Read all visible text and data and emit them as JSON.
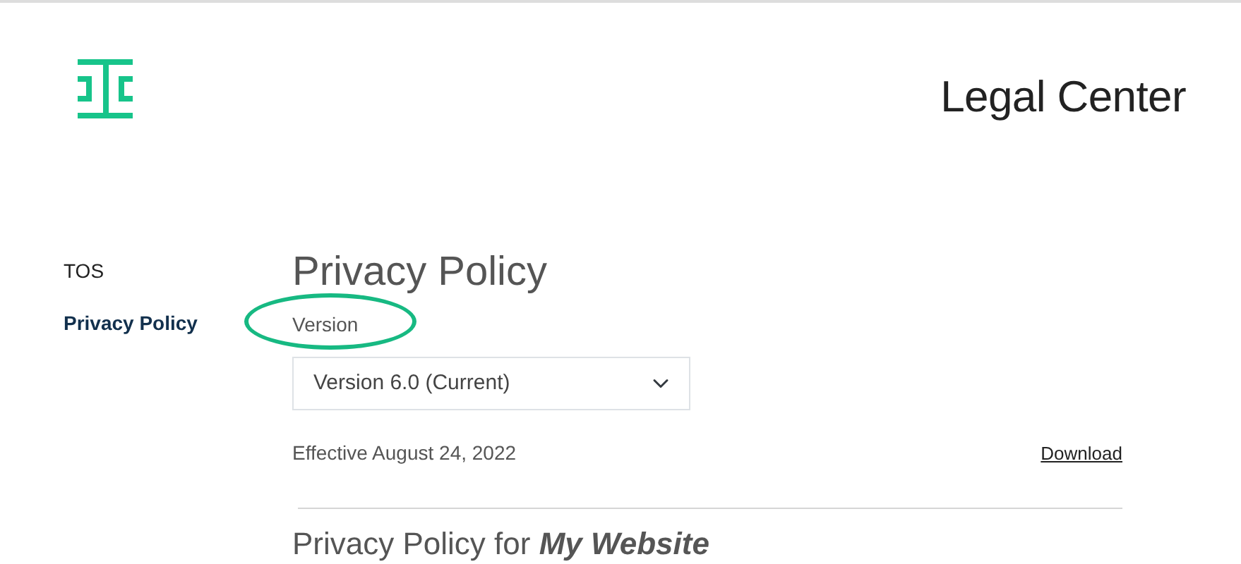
{
  "header": {
    "title": "Legal Center"
  },
  "sidebar": {
    "items": [
      {
        "label": "TOS",
        "selected": false
      },
      {
        "label": "Privacy Policy",
        "selected": true
      }
    ]
  },
  "main": {
    "title": "Privacy Policy",
    "version": {
      "label": "Version",
      "highlighted": true,
      "value": "Version 6.0  (Current)"
    },
    "effective": "Effective August 24, 2022",
    "download": "Download",
    "section_title": "Privacy Policy for **My Website**"
  }
}
